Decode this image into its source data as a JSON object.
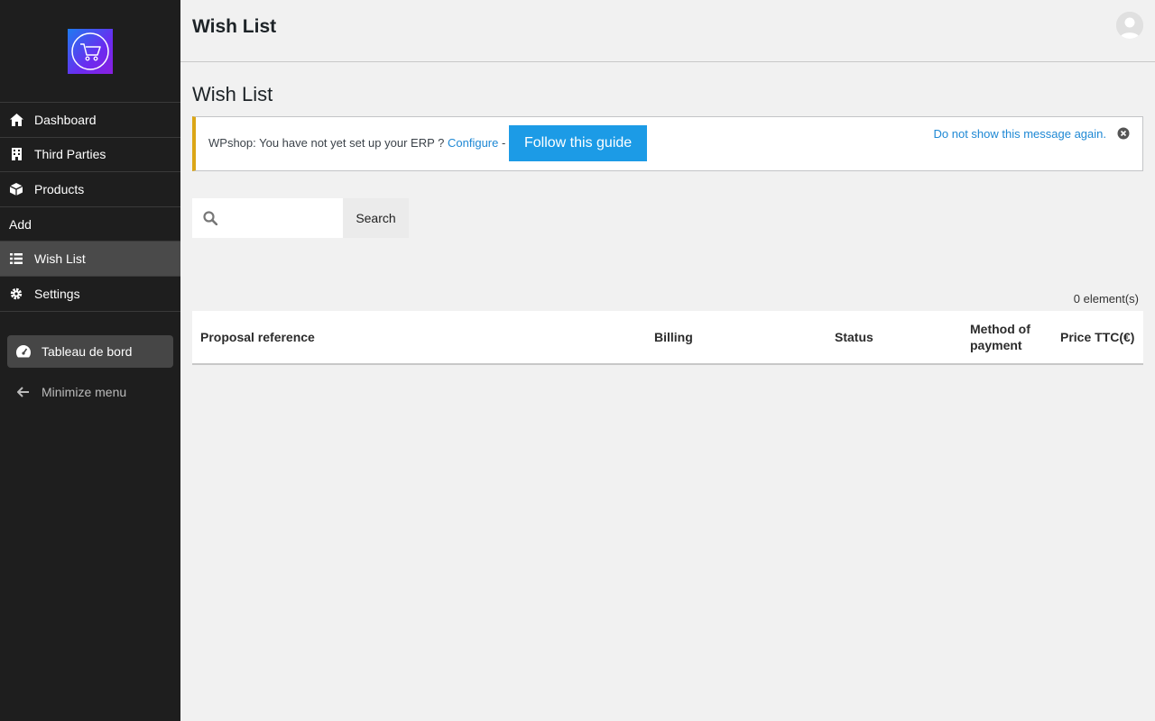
{
  "sidebar": {
    "items": [
      {
        "label": "Dashboard",
        "icon": "home-icon"
      },
      {
        "label": "Third Parties",
        "icon": "building-icon"
      },
      {
        "label": "Products",
        "icon": "cube-icon"
      },
      {
        "label": "Add",
        "icon": ""
      },
      {
        "label": "Wish List",
        "icon": "list-icon",
        "active": true
      },
      {
        "label": "Settings",
        "icon": "gear-icon"
      }
    ],
    "tableau_label": "Tableau de bord",
    "minimize_label": "Minimize menu"
  },
  "header": {
    "title": "Wish List"
  },
  "main": {
    "title": "Wish List",
    "notice": {
      "text": "WPshop: You have not yet set up your ERP ? ",
      "configure_link": "Configure",
      "separator": " -",
      "guide_button": "Follow this guide",
      "dismiss_link": "Do not show this message again."
    },
    "search": {
      "placeholder": "",
      "button_label": "Search"
    },
    "count": "0 element(s)",
    "table": {
      "columns": [
        "Proposal reference",
        "Billing",
        "Status",
        "Method of payment",
        "Price TTC(€)"
      ]
    }
  },
  "colors": {
    "accent": "#1c9be6",
    "notice_border": "#dba617",
    "sidebar_bg": "#1e1e1e"
  }
}
